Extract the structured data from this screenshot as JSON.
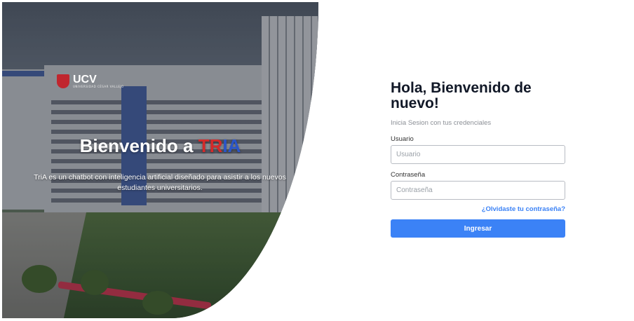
{
  "hero": {
    "logo_text": "UCV",
    "logo_subtext": "UNIVERSIDAD CÉSAR VALLEJO",
    "title_prefix": "Bienvenido a ",
    "title_brand_part1": "TR",
    "title_brand_part2": "IA",
    "description": "TriA es un chatbot con inteligencia artificial diseñado para asistir a los nuevos estudiantes universitarios.",
    "brand_colors": {
      "red": "#d42a2a",
      "blue": "#2a55c8"
    }
  },
  "login": {
    "heading": "Hola, Bienvenido de nuevo!",
    "subtitle": "Inicia Sesion con tus credenciales",
    "username_label": "Usuario",
    "username_placeholder": "Usuario",
    "username_value": "",
    "password_label": "Contraseña",
    "password_placeholder": "Contraseña",
    "password_value": "",
    "forgot_link": "¿Olvidaste tu contraseña?",
    "submit_label": "Ingresar",
    "accent_color": "#3b82f6"
  }
}
